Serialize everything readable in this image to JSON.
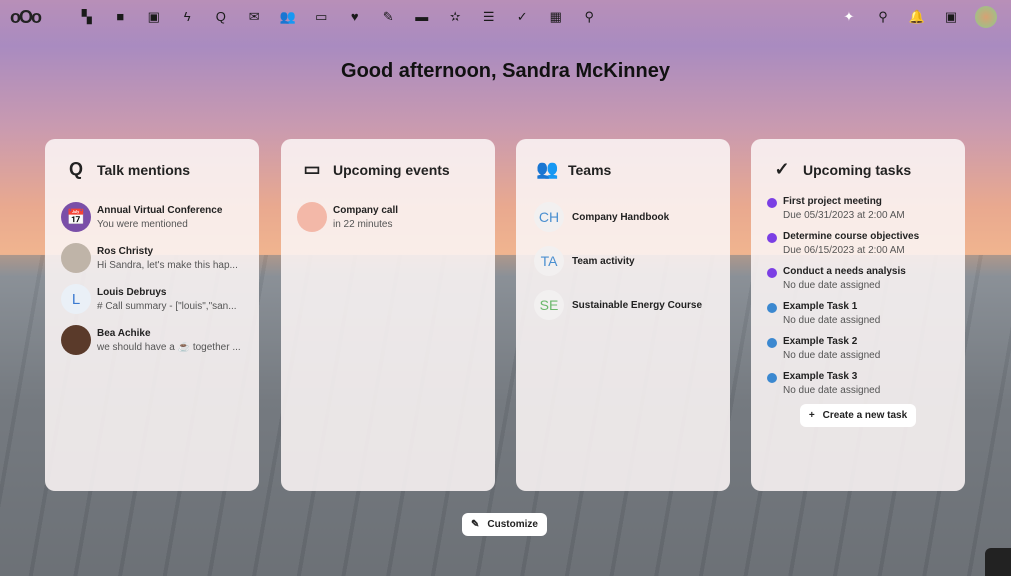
{
  "topbar": {
    "logo": "oOo",
    "apps": [
      {
        "name": "dashboard-icon",
        "glyph": "▚"
      },
      {
        "name": "files-icon",
        "glyph": "■"
      },
      {
        "name": "photos-icon",
        "glyph": "▣"
      },
      {
        "name": "activity-icon",
        "glyph": "ϟ"
      },
      {
        "name": "talk-icon",
        "glyph": "Q"
      },
      {
        "name": "mail-icon",
        "glyph": "✉"
      },
      {
        "name": "contacts-icon",
        "glyph": "👥"
      },
      {
        "name": "calendar-icon",
        "glyph": "▭"
      },
      {
        "name": "favorites-icon",
        "glyph": "♥"
      },
      {
        "name": "notes-icon",
        "glyph": "✎"
      },
      {
        "name": "deck-icon",
        "glyph": "▬"
      },
      {
        "name": "ai-icon",
        "glyph": "✫"
      },
      {
        "name": "tasks-list-icon",
        "glyph": "☰"
      },
      {
        "name": "tasks-check-icon",
        "glyph": "✓"
      },
      {
        "name": "tables-icon",
        "glyph": "▦"
      },
      {
        "name": "maps-icon",
        "glyph": "⚲"
      }
    ],
    "right": [
      {
        "name": "assistant-icon",
        "glyph": "✦"
      },
      {
        "name": "search-icon",
        "glyph": "⚲"
      },
      {
        "name": "notifications-icon",
        "glyph": "🔔"
      },
      {
        "name": "contacts-menu-icon",
        "glyph": "▣"
      }
    ]
  },
  "greeting": "Good afternoon, Sandra McKinney",
  "talk": {
    "title": "Talk mentions",
    "items": [
      {
        "name": "Annual Virtual Conference",
        "text": "You were mentioned",
        "avatar": "📅",
        "color": "#7a4fa8"
      },
      {
        "name": "Ros Christy",
        "text": "Hi Sandra, let's make this hap...",
        "avatar": "",
        "color": "#bfb4a8"
      },
      {
        "name": "Louis Debruys",
        "text": "# Call summary - [\"louis\",\"san...",
        "avatar": "L",
        "color": "#eaf0f7"
      },
      {
        "name": "Bea Achike",
        "text": "we should have a ☕ together ...",
        "avatar": "",
        "color": "#5a3a2a"
      }
    ]
  },
  "events": {
    "title": "Upcoming events",
    "items": [
      {
        "name": "Company call",
        "text": "in 22 minutes",
        "color": "#f3b8a8"
      }
    ]
  },
  "teams": {
    "title": "Teams",
    "items": [
      {
        "initials": "CH",
        "name": "Company Handbook",
        "color": "#4a8fd0"
      },
      {
        "initials": "TA",
        "name": "Team activity",
        "color": "#4a8fd0"
      },
      {
        "initials": "SE",
        "name": "Sustainable Energy Course",
        "color": "#6bb86b"
      }
    ]
  },
  "tasks": {
    "title": "Upcoming tasks",
    "items": [
      {
        "name": "First project meeting",
        "due": "Due 05/31/2023 at 2:00 AM",
        "color": "#7b3fe4"
      },
      {
        "name": "Determine course objectives",
        "due": "Due 06/15/2023 at 2:00 AM",
        "color": "#7b3fe4"
      },
      {
        "name": "Conduct a needs analysis",
        "due": "No due date assigned",
        "color": "#7b3fe4"
      },
      {
        "name": "Example Task 1",
        "due": "No due date assigned",
        "color": "#3b88d0"
      },
      {
        "name": "Example Task 2",
        "due": "No due date assigned",
        "color": "#3b88d0"
      },
      {
        "name": "Example Task 3",
        "due": "No due date assigned",
        "color": "#3b88d0"
      }
    ],
    "create_label": "Create a new task"
  },
  "customize_label": "Customize"
}
